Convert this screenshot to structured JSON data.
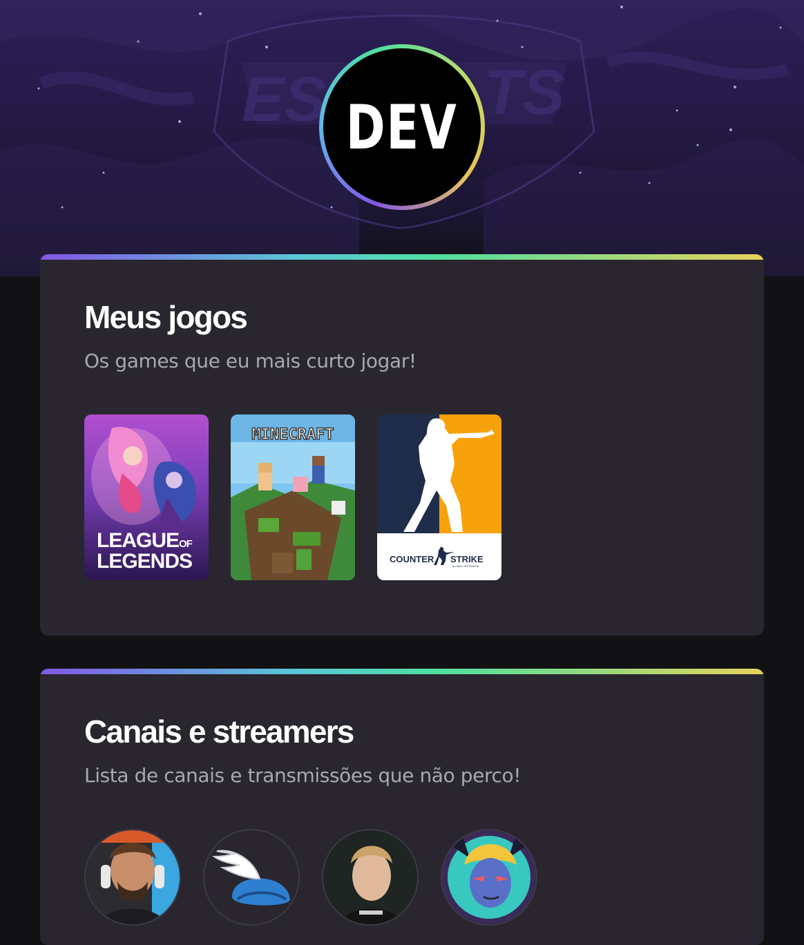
{
  "profile": {
    "avatar_text": "DEV",
    "avatar_alt": "DEV logo avatar"
  },
  "sections": {
    "games": {
      "title": "Meus jogos",
      "subtitle": "Os games que eu mais curto jogar!",
      "items": [
        {
          "name": "League of Legends",
          "cover_text_1": "LEAGUE",
          "cover_text_of": "OF",
          "cover_text_2": "LEGENDS"
        },
        {
          "name": "Minecraft",
          "cover_text": "MINECRAFT"
        },
        {
          "name": "Counter-Strike: Global Offensive",
          "cover_text_1": "COUNTER",
          "cover_text_2": "STRIKE",
          "cover_text_3": "GLOBAL OFFENSIVE"
        }
      ]
    },
    "streamers": {
      "title": "Canais e streamers",
      "subtitle": "Lista de canais e transmissões que não perco!",
      "items": [
        {
          "icon": "streamer-avatar-1"
        },
        {
          "icon": "winged-helmet-avatar"
        },
        {
          "icon": "streamer-avatar-3"
        },
        {
          "icon": "cartoon-avatar-4"
        }
      ]
    }
  },
  "colors": {
    "page_bg": "#121214",
    "card_bg": "#29262f",
    "accent_purple": "#8257e5",
    "accent_green": "#4fe0a0",
    "accent_yellow": "#e6d25c",
    "subtitle_gray": "#a8a8b3"
  }
}
